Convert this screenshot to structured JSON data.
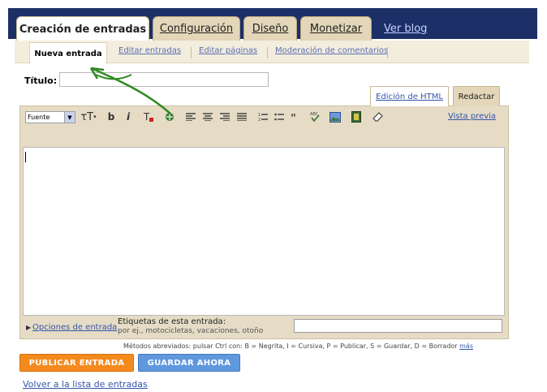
{
  "tabs": [
    {
      "label": "Creación de entradas",
      "active": true
    },
    {
      "label": "Configuración",
      "active": false
    },
    {
      "label": "Diseño",
      "active": false
    },
    {
      "label": "Monetizar",
      "active": false
    }
  ],
  "view_blog": "Ver blog",
  "subtabs": [
    {
      "label": "Nueva entrada",
      "active": true
    },
    {
      "label": "Editar entradas",
      "active": false
    },
    {
      "label": "Editar páginas",
      "active": false
    },
    {
      "label": "Moderación de comentarios",
      "active": false
    }
  ],
  "title_label": "Título:",
  "title_value": "",
  "mode_tabs": {
    "html": "Edición de HTML",
    "compose": "Redactar"
  },
  "toolbar": {
    "font_select": "Fuente",
    "size": "τT",
    "bold": "b",
    "italic": "i",
    "preview": "Vista previa"
  },
  "options_link": "Opciones de entrada",
  "tags_label": "Etiquetas de esta entrada:",
  "tags_hint": "por ej., motocicletas, vacaciones, otoño",
  "shortcuts_text": "Métodos abreviados: pulsar Ctrl con: B = Negrita, I = Cursiva, P = Publicar, S = Guardar, D = Borrador",
  "shortcuts_more": "más",
  "buttons": {
    "publish": "PUBLICAR ENTRADA",
    "save": "GUARDAR AHORA"
  },
  "back_link": "Volver a la lista de entradas",
  "colors": {
    "topbar": "#1c2f66",
    "tab": "#e3d6b9",
    "publish": "#f48a1d",
    "save": "#5f98dd",
    "annotation_arrow": "#2f8a22"
  }
}
